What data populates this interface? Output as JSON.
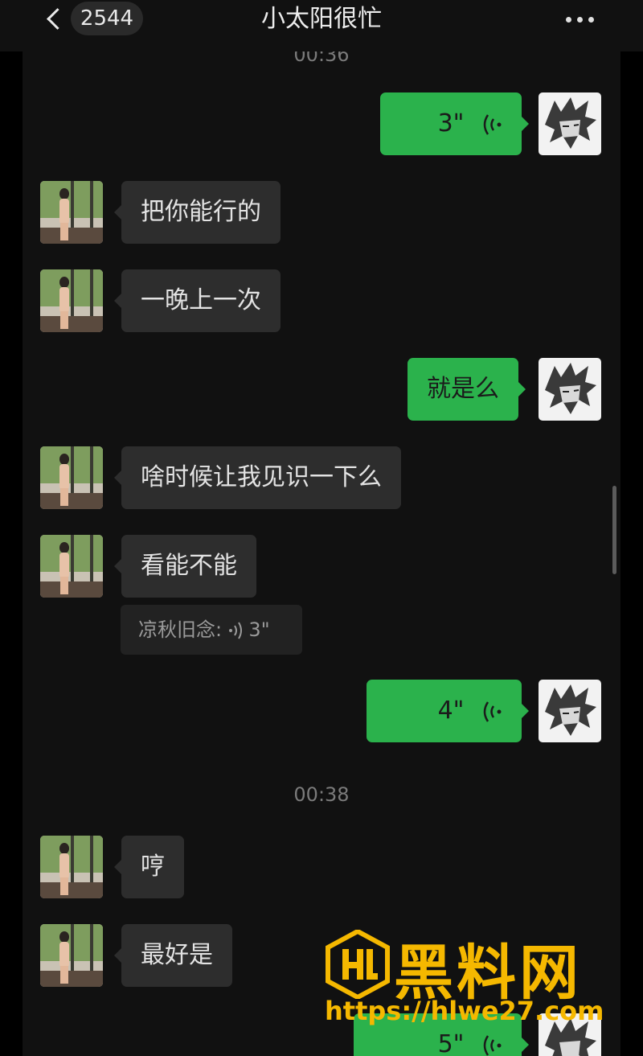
{
  "header": {
    "back_icon": "chevron-left-icon",
    "unread_count": "2544",
    "title": "小太阳很忙",
    "more_icon": "more-horizontal-icon"
  },
  "timestamps": [
    "00:36",
    "00:38"
  ],
  "messages": [
    {
      "side": "out",
      "type": "voice",
      "duration": "3\""
    },
    {
      "side": "in",
      "type": "text",
      "text": "把你能行的"
    },
    {
      "side": "in",
      "type": "text",
      "text": "一晚上一次"
    },
    {
      "side": "out",
      "type": "text",
      "text": "就是么"
    },
    {
      "side": "in",
      "type": "text",
      "text": "啥时候让我见识一下么"
    },
    {
      "side": "in",
      "type": "text",
      "text": "看能不能"
    },
    {
      "side": "out",
      "type": "voice",
      "duration": "4\""
    },
    {
      "side": "in",
      "type": "text",
      "text": "哼"
    },
    {
      "side": "in",
      "type": "text",
      "text": "最好是"
    },
    {
      "side": "out",
      "type": "voice",
      "duration": "5\""
    }
  ],
  "quote": {
    "sender": "凉秋旧念",
    "duration": "3\""
  },
  "watermark": {
    "brand": "黑料网",
    "url": "https://hlwe27.com"
  },
  "colors": {
    "background": "#111111",
    "outgoing_bubble": "#2bb24c",
    "incoming_bubble": "#2d2d2d",
    "watermark": "#f5b800"
  }
}
